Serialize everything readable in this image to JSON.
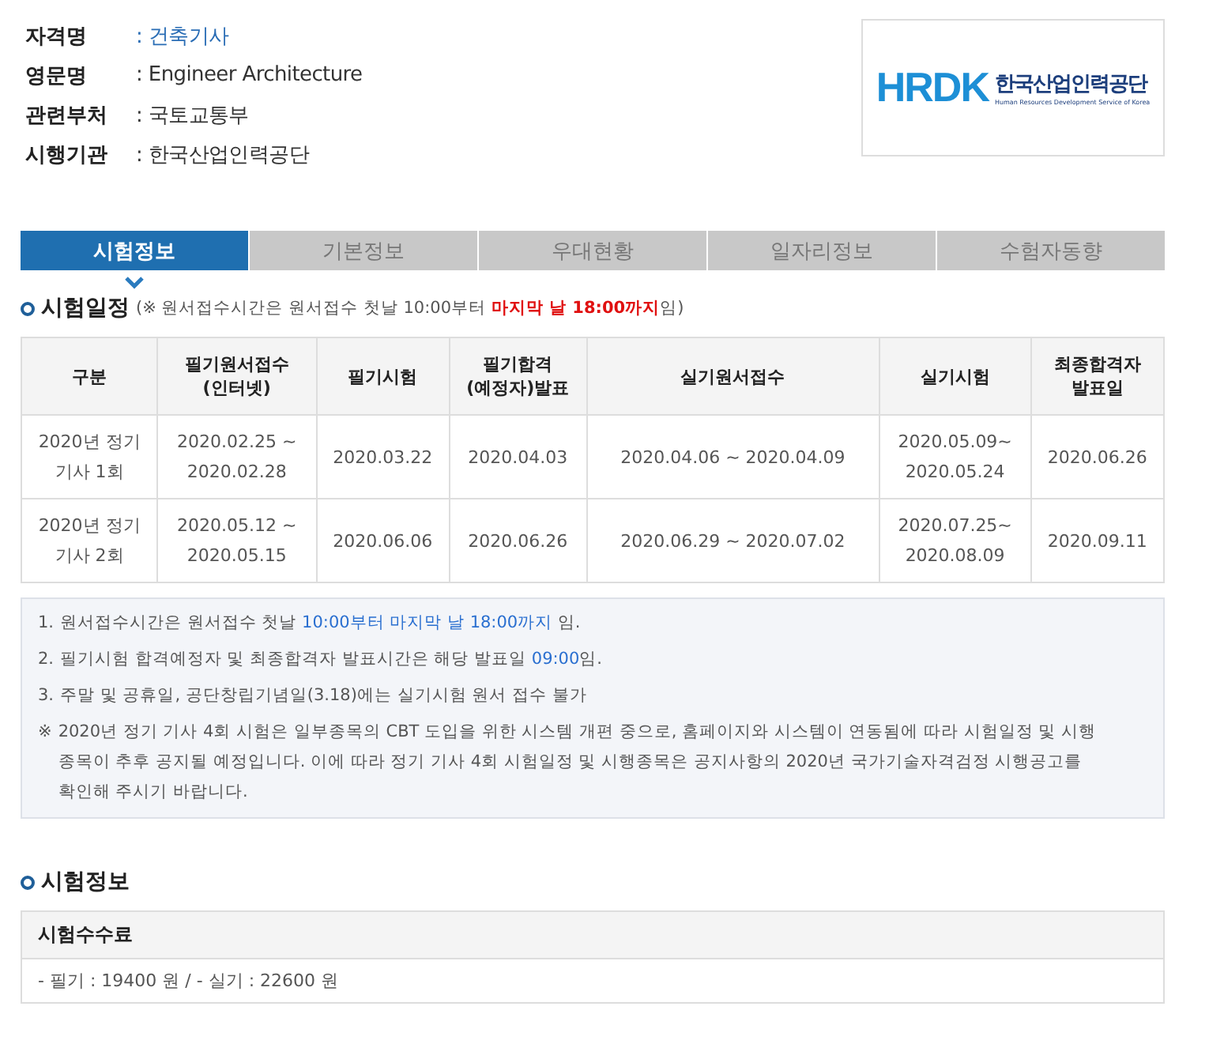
{
  "info": [
    {
      "label": "자격명",
      "value": ": 건축기사",
      "highlight": true
    },
    {
      "label": "영문명",
      "value": ": Engineer Architecture",
      "highlight": false
    },
    {
      "label": "관련부처",
      "value": ": 국토교통부",
      "highlight": false
    },
    {
      "label": "시행기관",
      "value": ": 한국산업인력공단",
      "highlight": false
    }
  ],
  "logo": {
    "mark": "HRDK",
    "name": "한국산업인력공단",
    "subtitle": "Human Resources Development Service of Korea"
  },
  "tabs": [
    {
      "label": "시험정보",
      "selected": true
    },
    {
      "label": "기본정보",
      "selected": false
    },
    {
      "label": "우대현황",
      "selected": false
    },
    {
      "label": "일자리정보",
      "selected": false
    },
    {
      "label": "수험자동향",
      "selected": false
    }
  ],
  "schedule": {
    "title": "시험일정",
    "note": [
      {
        "text": "(※ 원서접수시간은 원서접수 첫날 10:00부터 ",
        "emphasis": false
      },
      {
        "text": "마지막 날 18:00까지",
        "emphasis": true
      },
      {
        "text": "임)",
        "emphasis": false
      }
    ],
    "columns": [
      "구분",
      "필기원서접수\n(인터넷)",
      "필기시험",
      "필기합격\n(예정자)발표",
      "실기원서접수",
      "실기시험",
      "최종합격자\n발표일"
    ],
    "rows": [
      [
        "2020년 정기\n기사 1회",
        "2020.02.25 ~\n2020.02.28",
        "2020.03.22",
        "2020.04.03",
        "2020.04.06 ~ 2020.04.09",
        "2020.05.09~\n2020.05.24",
        "2020.06.26"
      ],
      [
        "2020년 정기\n기사 2회",
        "2020.05.12 ~\n2020.05.15",
        "2020.06.06",
        "2020.06.26",
        "2020.06.29 ~ 2020.07.02",
        "2020.07.25~\n2020.08.09",
        "2020.09.11"
      ]
    ]
  },
  "notes": [
    {
      "marker": "1.",
      "segments": [
        {
          "text": "원서접수시간은 원서접수 첫날 ",
          "emphasis": false
        },
        {
          "text": "10:00부터 마지막 날 18:00까지",
          "emphasis": true
        },
        {
          "text": " 임.",
          "emphasis": false
        }
      ]
    },
    {
      "marker": "2.",
      "segments": [
        {
          "text": "필기시험 합격예정자 및 최종합격자 발표시간은 해당 발표일 ",
          "emphasis": false
        },
        {
          "text": "09:00",
          "emphasis": true
        },
        {
          "text": "임.",
          "emphasis": false
        }
      ]
    },
    {
      "marker": "3.",
      "segments": [
        {
          "text": "주말 및 공휴일, 공단창립기념일(3.18)에는 실기시험 원서 접수 불가",
          "emphasis": false
        }
      ]
    },
    {
      "marker": "※",
      "segments": [
        {
          "text": "2020년 정기 기사 4회 시험은 일부종목의 CBT 도입을 위한 시스템 개편 중으로, 홈페이지와 시스템이 연동됨에 따라 시험일정 및 시행종목이 추후 공지될 예정입니다. 이에 따라 정기 기사 4회 시험일정 및 시행종목은 공지사항의 2020년 국가기술자격검정 시행공고를 확인해 주시기 바랍니다.",
          "emphasis": false
        }
      ]
    }
  ],
  "exam_info": {
    "title": "시험정보",
    "fee_title": "시험수수료",
    "fee": "- 필기 : 19400 원 / - 실기 : 22600 원"
  }
}
